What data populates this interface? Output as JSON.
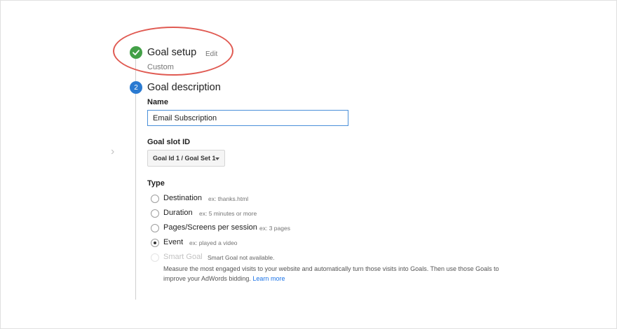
{
  "steps": [
    {
      "number": "1",
      "status": "complete",
      "title": "Goal setup",
      "edit_label": "Edit",
      "subtitle": "Custom"
    },
    {
      "number": "2",
      "status": "active",
      "title": "Goal description"
    }
  ],
  "form": {
    "name_label": "Name",
    "name_value": "Email Subscription",
    "slot_label": "Goal slot ID",
    "slot_value": "Goal Id 1 / Goal Set 1",
    "type_label": "Type",
    "type_options": [
      {
        "label": "Destination",
        "hint": "ex: thanks.html",
        "selected": false
      },
      {
        "label": "Duration",
        "hint": "ex: 5 minutes or more",
        "selected": false
      },
      {
        "label": "Pages/Screens per session",
        "hint": "ex: 3 pages",
        "selected": false
      },
      {
        "label": "Event",
        "hint": "ex: played a video",
        "selected": true
      }
    ],
    "smart_goal": {
      "label": "Smart Goal",
      "status": "Smart Goal not available.",
      "description": "Measure the most engaged visits to your website and automatically turn those visits into Goals. Then use those Goals to improve your AdWords bidding.",
      "link": "Learn more",
      "enabled": false
    }
  },
  "icons": {
    "step_complete": "check-icon",
    "collapse": "chevron-right-icon",
    "dropdown": "caret-down-icon"
  },
  "colors": {
    "complete": "#43a047",
    "active": "#2a7ad1",
    "input_focus": "#4a90d9",
    "link": "#1a73e8",
    "annotation": "#e05a52"
  }
}
